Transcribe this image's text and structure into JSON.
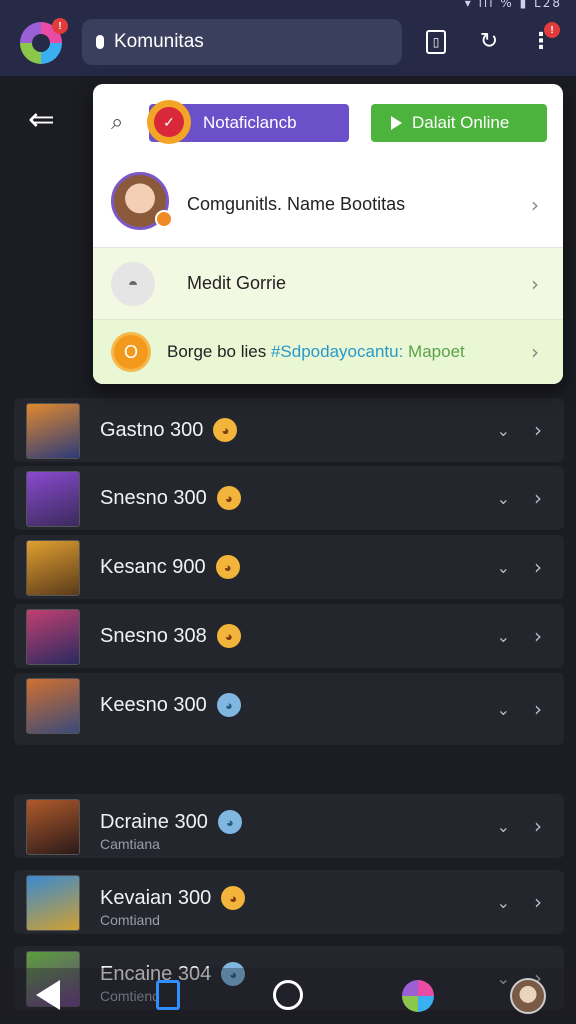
{
  "topbar": {
    "status_text": "▾ ıll % ▮ L28",
    "logo_badge": "!",
    "search_text": "Komunitas",
    "more_badge": "!"
  },
  "popup": {
    "notification_button": "Notaficlancb",
    "notification_icon_glyph": "✓",
    "online_button": "Dalait Online",
    "profile_label": "Comgunitls. Name Bootitas",
    "game_label": "Medit Gorrie",
    "coin_glyph": "O",
    "bottom_label_prefix": "Borge bo lies",
    "bottom_label_tag": "#Sdpodayocantu:",
    "bottom_label_suffix": "Mapoet"
  },
  "list": [
    {
      "title": "Gastno 300",
      "emoji": "◕",
      "colors": [
        "#e0892e",
        "#2c3a7a"
      ]
    },
    {
      "title": "Snesno 300",
      "emoji": "◕",
      "colors": [
        "#8a4ad0",
        "#3a2a5a"
      ]
    },
    {
      "title": "Kesanc 900",
      "emoji": "◕",
      "colors": [
        "#e0a030",
        "#5a3a1a"
      ]
    },
    {
      "title": "Snesno 308",
      "emoji": "◕",
      "colors": [
        "#c04070",
        "#2a2a60"
      ]
    },
    {
      "title": "Keesno 300",
      "emoji": "◕",
      "colors": [
        "#d07030",
        "#3a4a7a"
      ],
      "blue": true
    },
    {
      "title": "Dcraine 300",
      "sub": "Camtiana",
      "emoji": "◕",
      "colors": [
        "#b05a2a",
        "#2a1a1a"
      ],
      "blue": true
    },
    {
      "title": "Kevaian 300",
      "sub": "Comtiand",
      "emoji": "◕",
      "colors": [
        "#3a8ad0",
        "#d0a030"
      ]
    },
    {
      "title": "Encaine 304",
      "sub": "Comtiend",
      "emoji": "◕",
      "colors": [
        "#5aa03a",
        "#6a3a8a"
      ],
      "blue": true
    }
  ],
  "colors": {
    "topbar": "#262a47",
    "background": "#1c1d23",
    "notification_purple": "#6c50c9",
    "online_green": "#4cb33c"
  }
}
